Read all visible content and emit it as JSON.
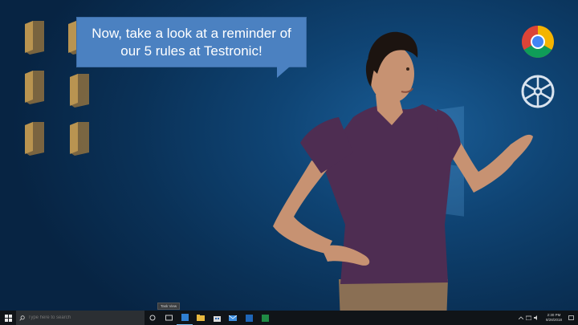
{
  "speech_bubble": {
    "line1": "Now, take a look at a reminder of",
    "line2": "our 5 rules at Testronic!",
    "color": "#4b81c1"
  },
  "desktop": {
    "background": "#0f4474",
    "icons": [
      "folder-icon",
      "folder-icon",
      "folder-icon",
      "folder-icon",
      "folder-icon",
      "folder-icon"
    ],
    "right_icons": [
      "chrome-icon",
      "film-reel-icon"
    ]
  },
  "taskbar": {
    "search_placeholder": "Type here to search",
    "tooltip": "Task View",
    "clock_time": "2:30 PM",
    "clock_date": "8/28/2018",
    "pinned": [
      "task-view-icon",
      "store-icon",
      "edge-icon",
      "file-explorer-icon",
      "mail-icon",
      "app-icon",
      "outlook-icon",
      "excel-icon"
    ]
  }
}
